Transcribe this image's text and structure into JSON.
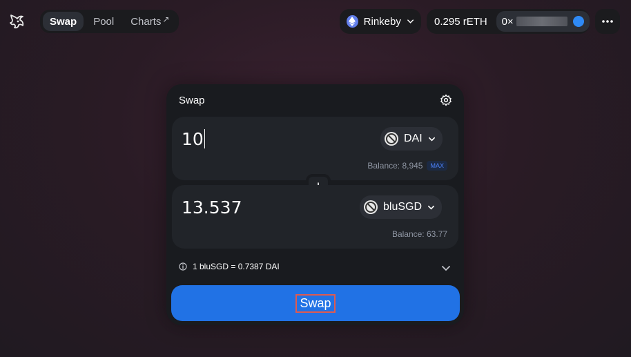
{
  "nav": {
    "tabs": [
      {
        "label": "Swap"
      },
      {
        "label": "Pool"
      },
      {
        "label": "Charts"
      }
    ],
    "charts_arrow": "↗"
  },
  "network": {
    "label": "Rinkeby"
  },
  "account": {
    "balance": "0.295 rETH",
    "address_prefix": "0×"
  },
  "swap": {
    "title": "Swap",
    "input": {
      "amount": "10",
      "token": "DAI",
      "balance": "Balance: 8,945",
      "max": "MAX"
    },
    "output": {
      "amount": "13.537",
      "token": "bluSGD",
      "balance": "Balance: 63.77"
    },
    "rate": "1 bluSGD = 0.7387 DAI",
    "button": "Swap"
  },
  "colors": {
    "accent": "#2172e5",
    "highlight": "#e05a4f"
  }
}
